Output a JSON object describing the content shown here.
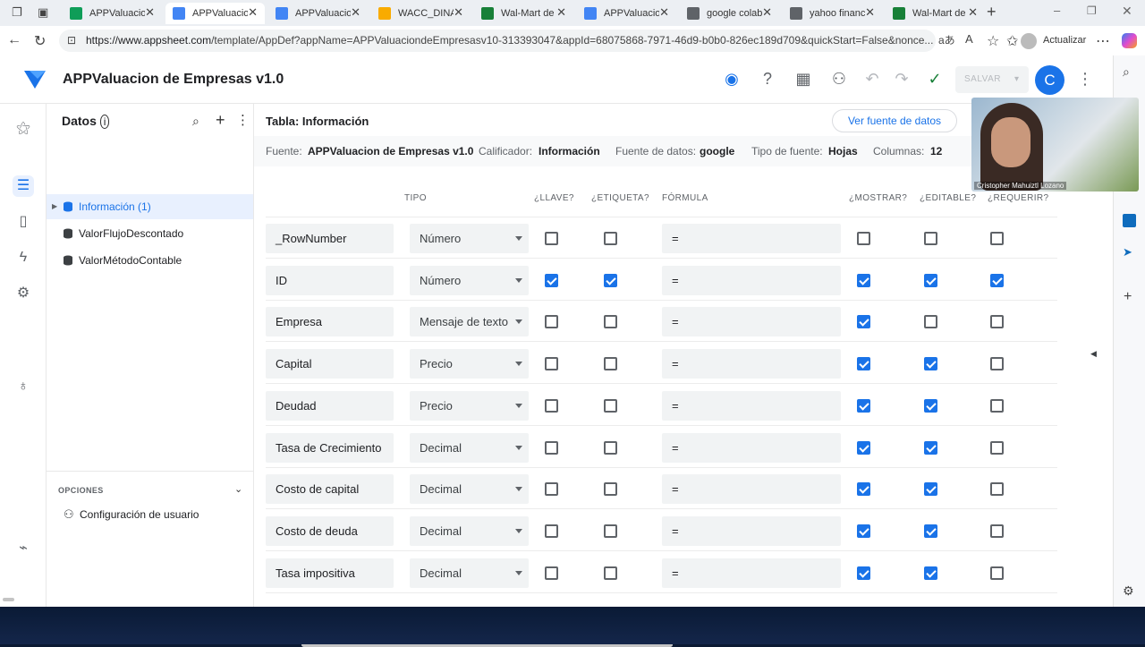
{
  "browser": {
    "tabs": [
      {
        "label": "APPValuacion",
        "icon": "sheets-icon",
        "color": "#0f9d58"
      },
      {
        "label": "APPValuacion",
        "icon": "appsheet-icon",
        "color": "#4285f4"
      },
      {
        "label": "APPValuacion",
        "icon": "appsheet-icon",
        "color": "#4285f4"
      },
      {
        "label": "WACC_DINAM",
        "icon": "colab-icon",
        "color": "#f9ab00"
      },
      {
        "label": "Wal-Mart de M",
        "icon": "tab-icon",
        "color": "#188038"
      },
      {
        "label": "APPValuacion",
        "icon": "appsheet-icon",
        "color": "#4285f4"
      },
      {
        "label": "google colab",
        "icon": "search-icon",
        "color": "#5f6368"
      },
      {
        "label": "yahoo financ",
        "icon": "search-icon",
        "color": "#5f6368"
      },
      {
        "label": "Wal-Mart de M",
        "icon": "tab-icon",
        "color": "#188038"
      }
    ],
    "url_host": "https://www.appsheet.com",
    "url_path": "/template/AppDef?appName=APPValuaciondeEmpresasv10-313393047&appId=68075868-7971-46d9-b0b0-826ec189d709&quickStart=False&nonce...",
    "update_label": "Actualizar"
  },
  "app": {
    "title": "APPValuacion de Empresas v1.0",
    "save_label": "SALVAR",
    "avatar_letter": "C"
  },
  "datapanel": {
    "heading": "Datos",
    "items": [
      "Información (1)",
      "ValorFlujoDescontado",
      "ValorMétodoContable"
    ],
    "options_heading": "OPCIONES",
    "options_item": "Configuración de usuario"
  },
  "table": {
    "title": "Tabla: Información",
    "view_source_label": "Ver fuente de datos",
    "meta": {
      "source_key": "Fuente:",
      "source_val": "APPValuacion de Empresas v1.0",
      "qualifier_key": "Calificador:",
      "qualifier_val": "Información",
      "datasource_key": "Fuente de datos:",
      "datasource_val": "google",
      "sourcetype_key": "Tipo de fuente:",
      "sourcetype_val": "Hojas",
      "columns_key": "Columnas:",
      "columns_val": "12"
    },
    "headers": {
      "tipo": "TIPO",
      "llave": "¿LLAVE?",
      "etiqueta": "¿ETIQUETA?",
      "formula": "FÓRMULA",
      "mostrar": "¿MOSTRAR?",
      "editable": "¿EDITABLE?",
      "requerir": "¿REQUERIR?"
    },
    "rows": [
      {
        "name": "_RowNumber",
        "type": "Número",
        "formula": "=",
        "key": false,
        "label": false,
        "show": false,
        "editable": false,
        "require": false
      },
      {
        "name": "ID",
        "type": "Número",
        "formula": "=",
        "key": true,
        "label": true,
        "show": true,
        "editable": true,
        "require": true
      },
      {
        "name": "Empresa",
        "type": "Mensaje de texto",
        "formula": "=",
        "key": false,
        "label": false,
        "show": true,
        "editable": false,
        "require": false
      },
      {
        "name": "Capital",
        "type": "Precio",
        "formula": "=",
        "key": false,
        "label": false,
        "show": true,
        "editable": true,
        "require": false
      },
      {
        "name": "Deudad",
        "type": "Precio",
        "formula": "=",
        "key": false,
        "label": false,
        "show": true,
        "editable": true,
        "require": false
      },
      {
        "name": "Tasa de Crecimiento",
        "type": "Decimal",
        "formula": "=",
        "key": false,
        "label": false,
        "show": true,
        "editable": true,
        "require": false
      },
      {
        "name": "Costo de capital",
        "type": "Decimal",
        "formula": "=",
        "key": false,
        "label": false,
        "show": true,
        "editable": true,
        "require": false
      },
      {
        "name": "Costo de deuda",
        "type": "Decimal",
        "formula": "=",
        "key": false,
        "label": false,
        "show": true,
        "editable": true,
        "require": false
      },
      {
        "name": "Tasa impositiva",
        "type": "Decimal",
        "formula": "=",
        "key": false,
        "label": false,
        "show": true,
        "editable": true,
        "require": false
      }
    ]
  },
  "webcam": {
    "name": "Cristopher Mahuiztl Lozano"
  }
}
